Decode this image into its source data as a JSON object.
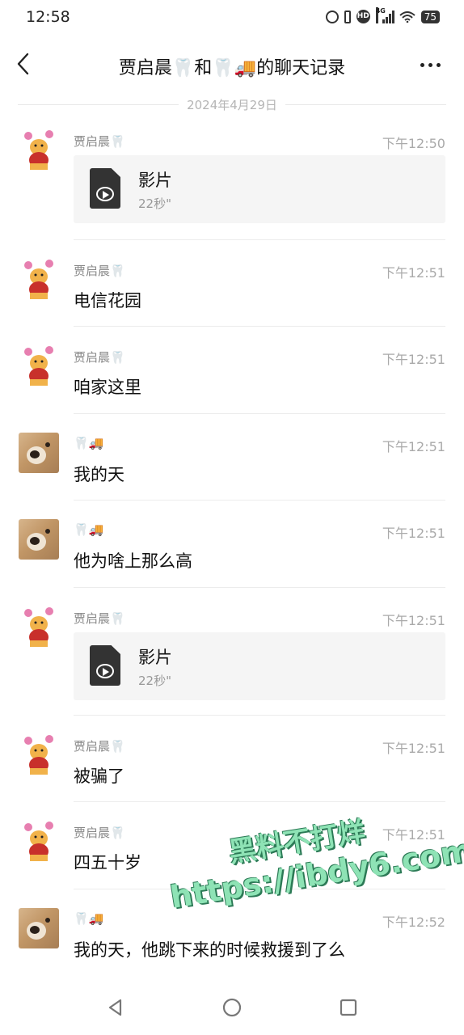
{
  "status_bar": {
    "time": "12:58",
    "network": "4G",
    "battery": "75"
  },
  "header": {
    "title": "贾启晨🦷和🦷🚚的聊天记录"
  },
  "date_separator": "2024年4月29日",
  "messages": [
    {
      "sender": "贾启晨🦷",
      "time": "下午12:50",
      "type": "file",
      "file_name": "影片",
      "file_duration": "22秒\"",
      "avatar": "pooh"
    },
    {
      "sender": "贾启晨🦷",
      "time": "下午12:51",
      "type": "text",
      "text": "电信花园",
      "avatar": "pooh"
    },
    {
      "sender": "贾启晨🦷",
      "time": "下午12:51",
      "type": "text",
      "text": "咱家这里",
      "avatar": "pooh"
    },
    {
      "sender": "🦷🚚",
      "time": "下午12:51",
      "type": "text",
      "text": "我的天",
      "avatar": "dog"
    },
    {
      "sender": "🦷🚚",
      "time": "下午12:51",
      "type": "text",
      "text": "他为啥上那么高",
      "avatar": "dog"
    },
    {
      "sender": "贾启晨🦷",
      "time": "下午12:51",
      "type": "file",
      "file_name": "影片",
      "file_duration": "22秒\"",
      "avatar": "pooh"
    },
    {
      "sender": "贾启晨🦷",
      "time": "下午12:51",
      "type": "text",
      "text": "被骗了",
      "avatar": "pooh"
    },
    {
      "sender": "贾启晨🦷",
      "time": "下午12:51",
      "type": "text",
      "text": "四五十岁",
      "avatar": "pooh"
    },
    {
      "sender": "🦷🚚",
      "time": "下午12:52",
      "type": "text",
      "text": "我的天，他跳下来的时候救援到了么",
      "avatar": "dog"
    }
  ],
  "watermark": {
    "line1": "黑料不打烊",
    "line2": "https://ibdy6.com"
  },
  "icons": {
    "back": "chevron-left-icon",
    "more": "more-dots-icon",
    "file": "video-file-icon",
    "nav_back": "triangle-back-icon",
    "nav_home": "circle-home-icon",
    "nav_recent": "square-recent-icon"
  },
  "colors": {
    "card_bg": "#f5f5f5",
    "watermark_green": "#8ee3b5"
  }
}
